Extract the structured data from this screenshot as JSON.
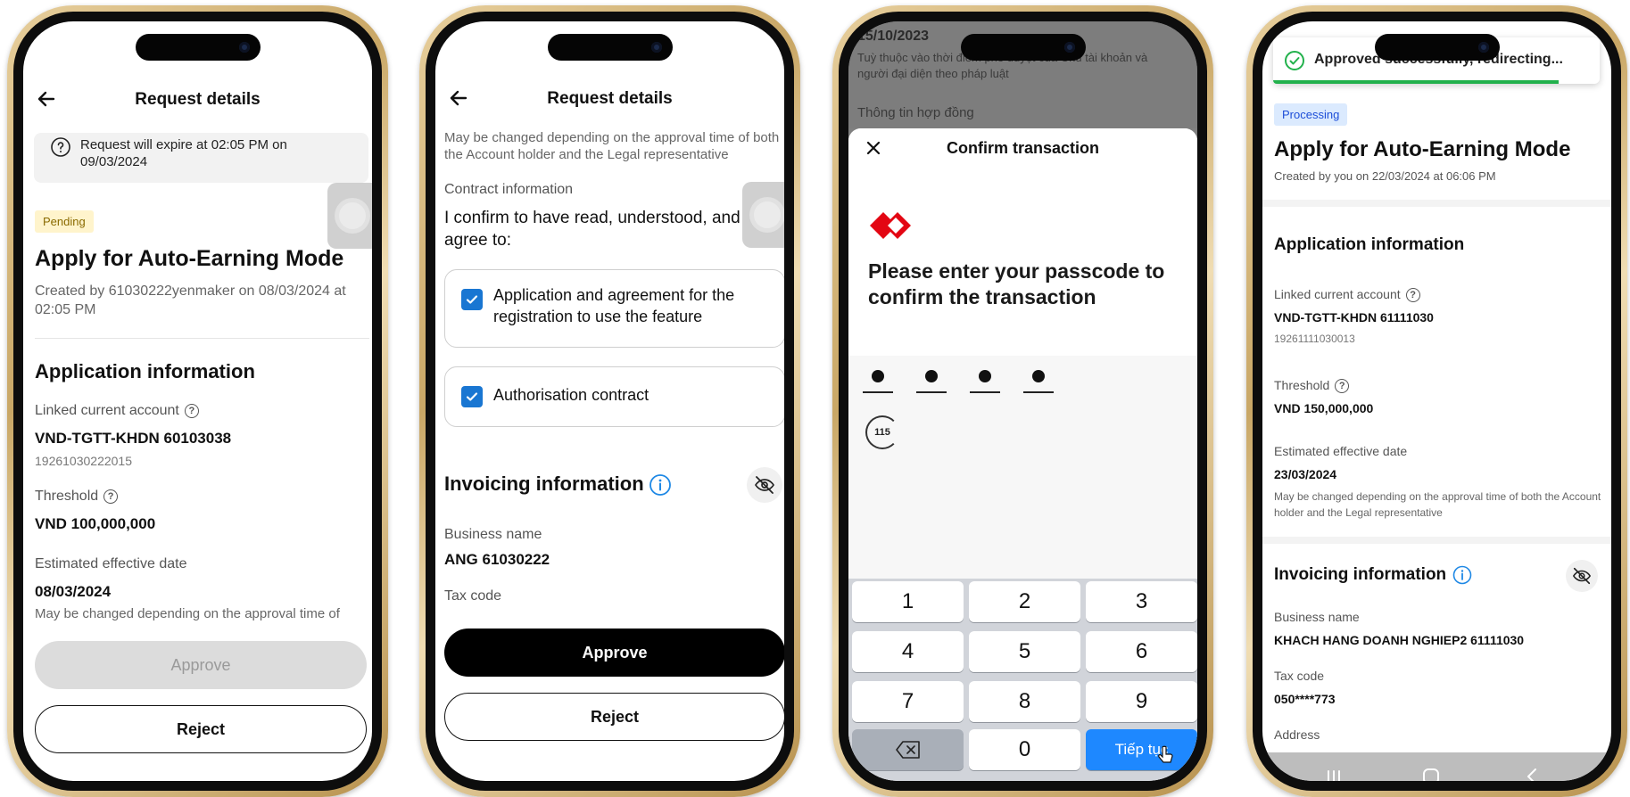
{
  "screen1": {
    "header_title": "Request details",
    "expire_notice": "Request will expire at 02:05 PM on 09/03/2024",
    "status_badge": "Pending",
    "title": "Apply for Auto-Earning Mode",
    "created_by": "Created by 61030222yenmaker on 08/03/2024 at 02:05 PM",
    "section_title": "Application information",
    "linked_account_label": "Linked current account",
    "linked_account_value": "VND-TGTT-KHDN 60103038",
    "linked_account_number": "19261030222015",
    "threshold_label": "Threshold",
    "threshold_value": "VND 100,000,000",
    "effective_date_label": "Estimated effective date",
    "effective_date_value": "08/03/2024",
    "effective_date_note": "May be changed depending on the approval time of",
    "approve_label": "Approve",
    "reject_label": "Reject"
  },
  "screen2": {
    "header_title": "Request details",
    "top_note": "May be changed depending on the approval time of both the Account holder and the Legal representative",
    "contract_label": "Contract information",
    "confirm_text": "I confirm to have read, understood, and agree to:",
    "agreement_1": "Application and agreement for the registration to use the feature",
    "agreement_2": "Authorisation contract",
    "invoicing_title": "Invoicing information",
    "business_name_label": "Business name",
    "business_name_value": "ANG 61030222",
    "tax_code_label": "Tax code",
    "approve_label": "Approve",
    "reject_label": "Reject"
  },
  "screen3": {
    "bg_date": "15/10/2023",
    "bg_note": "Tuỳ thuộc vào thời điểm phê duyệt của Chủ tài khoản và người đại diện theo pháp luật",
    "bg_section": "Thông tin hợp đồng",
    "sheet_title": "Confirm transaction",
    "prompt": "Please enter your passcode to confirm the transaction",
    "timer": "115",
    "keys": [
      "1",
      "2",
      "3",
      "4",
      "5",
      "6",
      "7",
      "8",
      "9"
    ],
    "key_zero": "0",
    "continue_label": "Tiếp tục",
    "brand_color": "#e30613",
    "key_accent": "#1e88ff"
  },
  "screen4": {
    "toast_text": "Approved successfully, redirecting...",
    "status_badge": "Processing",
    "title": "Apply for Auto-Earning Mode",
    "created_by": "Created by you on 22/03/2024 at 06:06 PM",
    "section_title": "Application information",
    "linked_account_label": "Linked current account",
    "linked_account_value": "VND-TGTT-KHDN 61111030",
    "linked_account_number": "19261111030013",
    "threshold_label": "Threshold",
    "threshold_value": "VND 150,000,000",
    "effective_date_label": "Estimated effective date",
    "effective_date_value": "23/03/2024",
    "effective_date_note": "May be changed depending on the approval time of both the Account holder and the Legal representative",
    "invoicing_title": "Invoicing information",
    "business_name_label": "Business name",
    "business_name_value": "KHACH HANG DOANH NGHIEP2 61111030",
    "tax_code_label": "Tax code",
    "tax_code_value": "050****773",
    "address_label": "Address",
    "success_color": "#22b14c",
    "processing_badge_color": "#dbeafe"
  }
}
